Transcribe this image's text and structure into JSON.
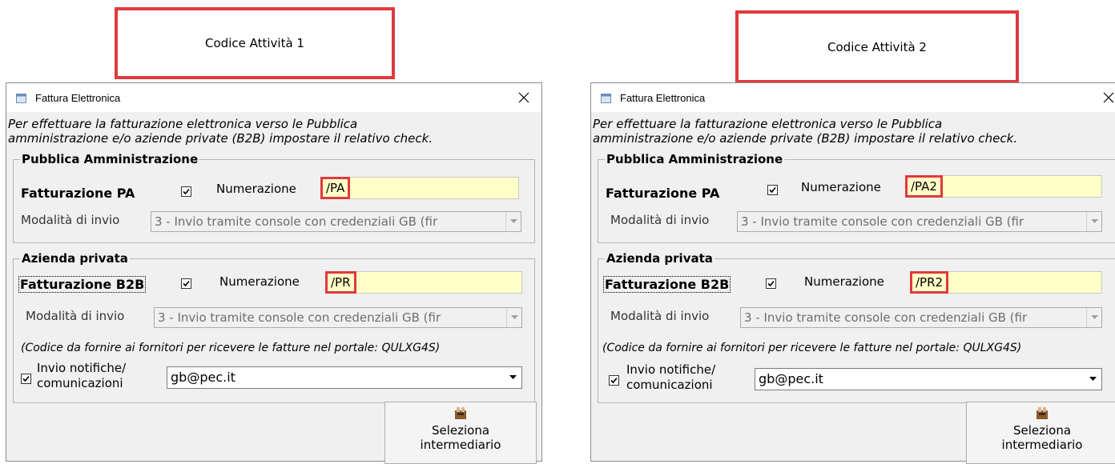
{
  "callouts": [
    "Codice Attività 1",
    "Codice Attività 2"
  ],
  "colors": {
    "highlight": "#e0393e",
    "field_bg": "#ffffc8"
  },
  "dialogs": [
    {
      "title": "Fattura Elettronica",
      "intro_line1": "Per effettuare la fatturazione elettronica verso le Pubblica",
      "intro_line2": "amministrazione e/o aziende private (B2B) impostare il relativo check.",
      "pa": {
        "group": "Pubblica Amministrazione",
        "label": "Fatturazione PA",
        "checked": true,
        "num_label": "Numerazione",
        "num_value": "/PA",
        "mode_label": "Modalità di invio",
        "mode_value": "3 - Invio tramite console con credenziali GB (fir"
      },
      "b2b": {
        "group": "Azienda privata",
        "label": "Fatturazione B2B",
        "checked": true,
        "num_label": "Numerazione",
        "num_value": "/PR",
        "mode_label": "Modalità di invio",
        "mode_value": "3 - Invio tramite console con credenziali GB (fir"
      },
      "code_note": "(Codice da fornire ai fornitori per ricevere le fatture nel portale: QULXG4S)",
      "notify_label1": "Invio notifiche/",
      "notify_label2": "comunicazioni",
      "notify_checked": true,
      "email": "gb@pec.it",
      "btn_line1": "Seleziona",
      "btn_line2": "intermediario"
    },
    {
      "title": "Fattura Elettronica",
      "intro_line1": "Per effettuare la fatturazione elettronica verso le Pubblica",
      "intro_line2": "amministrazione e/o aziende private (B2B) impostare il relativo check.",
      "pa": {
        "group": "Pubblica Amministrazione",
        "label": "Fatturazione PA",
        "checked": true,
        "num_label": "Numerazione",
        "num_value": "/PA2",
        "mode_label": "Modalità di invio",
        "mode_value": "3 - Invio tramite console con credenziali GB (fir"
      },
      "b2b": {
        "group": "Azienda privata",
        "label": "Fatturazione B2B",
        "checked": true,
        "num_label": "Numerazione",
        "num_value": "/PR2",
        "mode_label": "Modalità di invio",
        "mode_value": "3 - Invio tramite console con credenziali GB (fir"
      },
      "code_note": "(Codice da fornire ai fornitori per ricevere le fatture nel portale: QULXG4S)",
      "notify_label1": "Invio notifiche/",
      "notify_label2": "comunicazioni",
      "notify_checked": true,
      "email": "gb@pec.it",
      "btn_line1": "Seleziona",
      "btn_line2": "intermediario"
    }
  ]
}
